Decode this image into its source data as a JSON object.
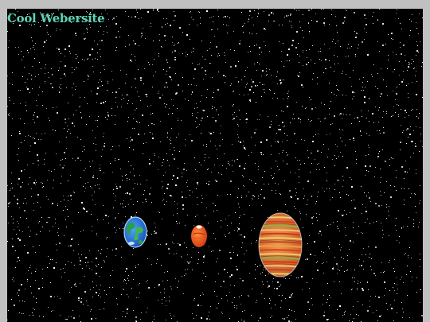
{
  "page": {
    "title": "Cool Webersite",
    "background_color": "#000000",
    "border_color": "#c0c0c0",
    "title_color": "#5fd3b8"
  },
  "planets": [
    {
      "name": "earth",
      "icon": "earth-icon"
    },
    {
      "name": "mars",
      "icon": "mars-icon"
    },
    {
      "name": "jupiter",
      "icon": "jupiter-icon"
    }
  ],
  "starfield": {
    "density": "dense",
    "star_color": "#ffffff"
  }
}
